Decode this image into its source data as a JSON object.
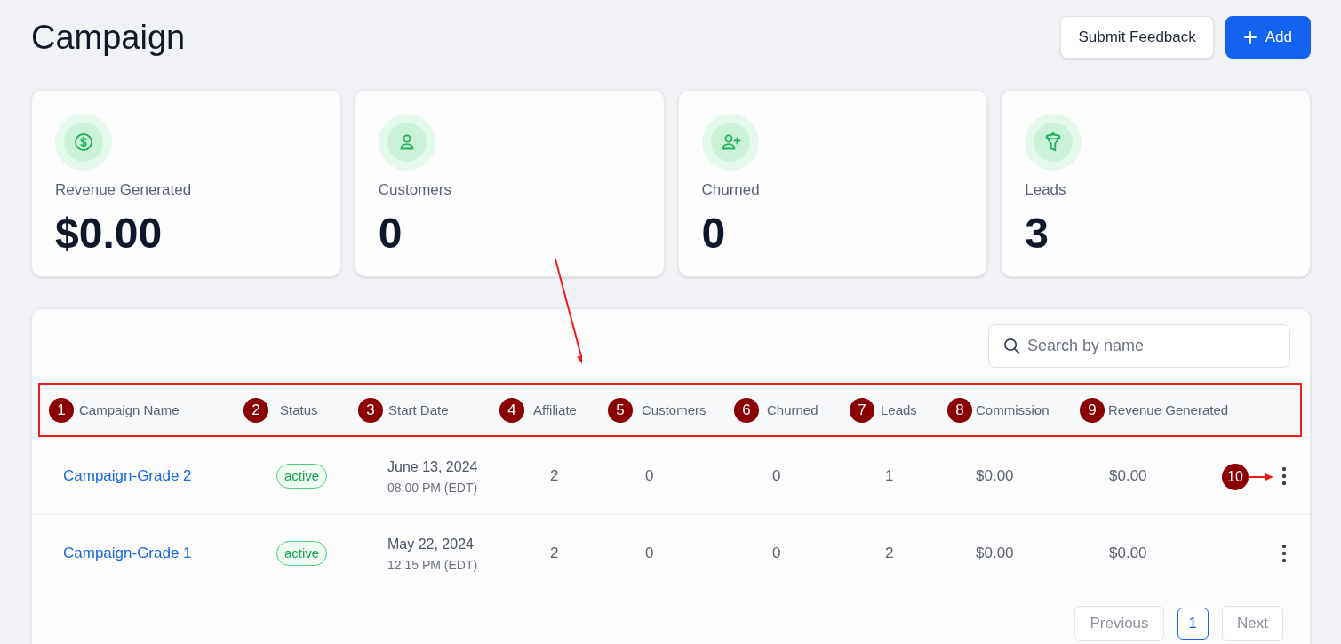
{
  "page": {
    "title": "Campaign",
    "actions": [
      {
        "label": "Submit Feedback",
        "kind": "secondary"
      },
      {
        "label": "Add",
        "kind": "primary"
      }
    ]
  },
  "stats": [
    {
      "label": "Revenue Generated",
      "value": "$0.00"
    },
    {
      "label": "Customers",
      "value": "0"
    },
    {
      "label": "Churned",
      "value": "0"
    },
    {
      "label": "Leads",
      "value": "3"
    }
  ],
  "table": {
    "search": {
      "placeholder": "Search by name"
    },
    "columns": [
      "Campaign Name",
      "Status",
      "Start Date",
      "Affiliate",
      "Customers",
      "Churned",
      "Leads",
      "Commission",
      "Revenue Generated"
    ],
    "rows": [
      {
        "name": "Campaign-Grade 2",
        "status": "active",
        "start_date": "June 13, 2024",
        "start_time": "08:00 PM (EDT)",
        "affiliate": "2",
        "customers": "0",
        "churned": "0",
        "leads": "1",
        "commission": "$0.00",
        "revenue_generated": "$0.00"
      },
      {
        "name": "Campaign-Grade 1",
        "status": "active",
        "start_date": "May 22, 2024",
        "start_time": "12:15 PM (EDT)",
        "affiliate": "2",
        "customers": "0",
        "churned": "0",
        "leads": "2",
        "commission": "$0.00",
        "revenue_generated": "$0.00"
      }
    ]
  },
  "pagination": [
    {
      "label": "Previous",
      "selected": false,
      "disabled": true
    },
    {
      "label": "1",
      "selected": true,
      "disabled": false
    },
    {
      "label": "Next",
      "selected": false,
      "disabled": true
    }
  ],
  "annotations": {
    "callouts": [
      "1",
      "2",
      "3",
      "4",
      "5",
      "6",
      "7",
      "8",
      "9",
      "10"
    ]
  }
}
